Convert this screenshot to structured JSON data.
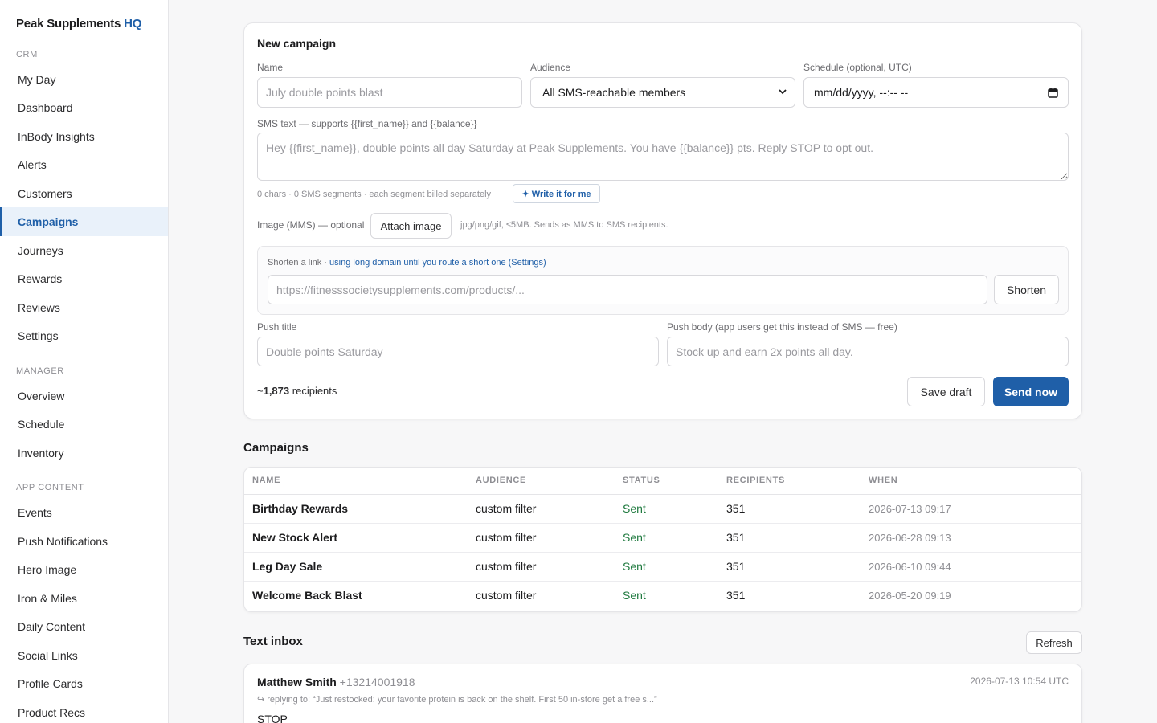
{
  "brand": {
    "name": "Peak Supplements",
    "suffix": "HQ"
  },
  "sidebar": {
    "sections": [
      {
        "title": "CRM",
        "items": [
          "My Day",
          "Dashboard",
          "InBody Insights",
          "Alerts",
          "Customers",
          "Campaigns",
          "Journeys",
          "Rewards",
          "Reviews",
          "Settings"
        ]
      },
      {
        "title": "MANAGER",
        "items": [
          "Overview",
          "Schedule",
          "Inventory"
        ]
      },
      {
        "title": "APP CONTENT",
        "items": [
          "Events",
          "Push Notifications",
          "Hero Image",
          "Iron & Miles",
          "Daily Content",
          "Social Links",
          "Profile Cards",
          "Product Recs"
        ]
      }
    ],
    "active": "Campaigns"
  },
  "new_campaign": {
    "title": "New campaign",
    "name_label": "Name",
    "name_placeholder": "July double points blast",
    "audience_label": "Audience",
    "audience_value": "All SMS-reachable members",
    "schedule_label": "Schedule (optional, UTC)",
    "schedule_value": "mm/dd/yyyy, --:-- --",
    "sms_label": "SMS text — supports {{first_name}} and {{balance}}",
    "sms_placeholder": "Hey {{first_name}}, double points all day Saturday at Peak Supplements. You have {{balance}} pts. Reply STOP to opt out.",
    "sms_counter": "0 chars · 0 SMS segments · each segment billed separately",
    "write_button": "✦ Write it for me",
    "image_label": "Image (MMS) — optional",
    "attach_button": "Attach image",
    "image_hint": "jpg/png/gif, ≤5MB. Sends as MMS to SMS recipients.",
    "shorten_label": "Shorten a link ·",
    "shorten_link": "using long domain until you route a short one (Settings)",
    "shorten_placeholder": "https://fitnesssocietysupplements.com/products/...",
    "shorten_button": "Shorten",
    "push_title_label": "Push title",
    "push_title_placeholder": "Double points Saturday",
    "push_body_label": "Push body (app users get this instead of SMS — free)",
    "push_body_placeholder": "Stock up and earn 2x points all day.",
    "recipients_prefix": "~",
    "recipients_count": "1,873",
    "recipients_suffix": "recipients",
    "save_button": "Save draft",
    "send_button": "Send now"
  },
  "campaigns": {
    "title": "Campaigns",
    "columns": [
      "NAME",
      "AUDIENCE",
      "STATUS",
      "RECIPIENTS",
      "WHEN"
    ],
    "rows": [
      {
        "name": "Birthday Rewards",
        "audience": "custom filter",
        "status": "Sent",
        "recipients": "351",
        "when": "2026-07-13 09:17"
      },
      {
        "name": "New Stock Alert",
        "audience": "custom filter",
        "status": "Sent",
        "recipients": "351",
        "when": "2026-06-28 09:13"
      },
      {
        "name": "Leg Day Sale",
        "audience": "custom filter",
        "status": "Sent",
        "recipients": "351",
        "when": "2026-06-10 09:44"
      },
      {
        "name": "Welcome Back Blast",
        "audience": "custom filter",
        "status": "Sent",
        "recipients": "351",
        "when": "2026-05-20 09:19"
      }
    ]
  },
  "inbox": {
    "title": "Text inbox",
    "refresh_button": "Refresh",
    "messages": [
      {
        "sender": "Matthew Smith",
        "phone": "+13214001918",
        "time": "2026-07-13 10:54 UTC",
        "reply_to": "↪ replying to: “Just restocked: your favorite protein is back on the shelf. First 50 in-store get a free s...”",
        "body": "STOP"
      }
    ]
  },
  "colors": {
    "accent": "#1f5fa8",
    "sent": "#1f7a3f"
  }
}
